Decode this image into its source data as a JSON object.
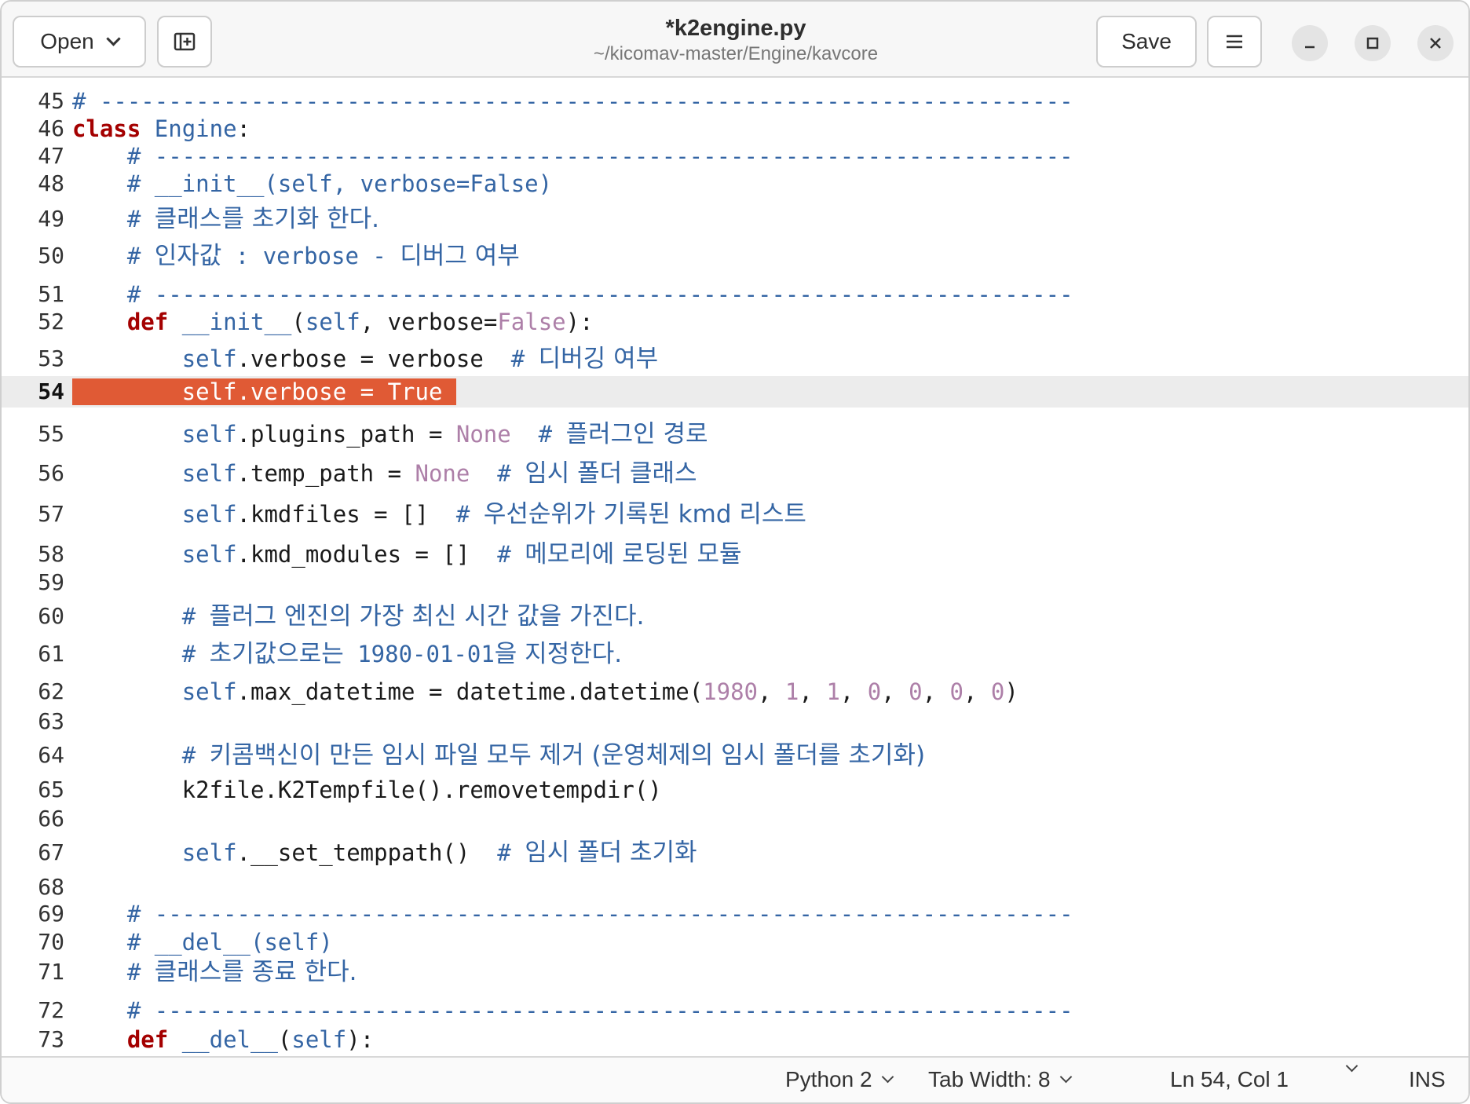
{
  "header": {
    "open_label": "Open",
    "title": "*k2engine.py",
    "path": "~/kicomav-master/Engine/kavcore",
    "save_label": "Save"
  },
  "icons": {
    "open_dropdown": "chevron-down-icon",
    "new_tab": "new-tab-icon",
    "menu": "hamburger-menu-icon",
    "minimize": "minimize-icon",
    "maximize": "maximize-icon",
    "close": "close-icon"
  },
  "colors": {
    "comment": "#3465a4",
    "keyword": "#a40000",
    "constant": "#ad7fa8",
    "current_line": "#ececec",
    "search_highlight": "#e05a35"
  },
  "editor": {
    "current_line": 54,
    "lines": [
      {
        "n": "45",
        "tokens": [
          {
            "t": "# -----------------------------------------------------------------------",
            "c": "cmt"
          }
        ]
      },
      {
        "n": "46",
        "tokens": [
          {
            "t": "class",
            "c": "kw"
          },
          {
            "t": " "
          },
          {
            "t": "Engine",
            "c": "cls"
          },
          {
            "t": ":"
          }
        ]
      },
      {
        "n": "47",
        "tokens": [
          {
            "t": "    "
          },
          {
            "t": "# -------------------------------------------------------------------",
            "c": "cmt"
          }
        ]
      },
      {
        "n": "48",
        "tokens": [
          {
            "t": "    "
          },
          {
            "t": "# __init__(self, verbose=False)",
            "c": "cmt"
          }
        ]
      },
      {
        "n": "49",
        "tokens": [
          {
            "t": "    "
          },
          {
            "t": "# ",
            "c": "cmt"
          },
          {
            "t": "클래스를 초기화 한다.",
            "c": "cmt ko"
          }
        ]
      },
      {
        "n": "50",
        "tokens": [
          {
            "t": "    "
          },
          {
            "t": "# ",
            "c": "cmt"
          },
          {
            "t": "인자값",
            "c": "cmt ko"
          },
          {
            "t": " : verbose - ",
            "c": "cmt"
          },
          {
            "t": "디버그 여부",
            "c": "cmt ko"
          }
        ]
      },
      {
        "n": "51",
        "tokens": [
          {
            "t": "    "
          },
          {
            "t": "# -------------------------------------------------------------------",
            "c": "cmt"
          }
        ]
      },
      {
        "n": "52",
        "tokens": [
          {
            "t": "    "
          },
          {
            "t": "def",
            "c": "kw"
          },
          {
            "t": " "
          },
          {
            "t": "__init__",
            "c": "cmt"
          },
          {
            "t": "("
          },
          {
            "t": "self",
            "c": "slf"
          },
          {
            "t": ", verbose="
          },
          {
            "t": "False",
            "c": "con"
          },
          {
            "t": "):"
          }
        ]
      },
      {
        "n": "53",
        "tokens": [
          {
            "t": "        "
          },
          {
            "t": "self",
            "c": "slf"
          },
          {
            "t": ".verbose = verbose  "
          },
          {
            "t": "# ",
            "c": "cmt"
          },
          {
            "t": "디버깅 여부",
            "c": "cmt ko"
          }
        ]
      },
      {
        "n": "54",
        "tokens": [
          {
            "t": "        self.verbose = True ",
            "c": "cur-hl"
          }
        ]
      },
      {
        "n": "55",
        "tokens": [
          {
            "t": "        "
          },
          {
            "t": "self",
            "c": "slf"
          },
          {
            "t": ".plugins_path = "
          },
          {
            "t": "None",
            "c": "con"
          },
          {
            "t": "  "
          },
          {
            "t": "# ",
            "c": "cmt"
          },
          {
            "t": "플러그인 경로",
            "c": "cmt ko"
          }
        ]
      },
      {
        "n": "56",
        "tokens": [
          {
            "t": "        "
          },
          {
            "t": "self",
            "c": "slf"
          },
          {
            "t": ".temp_path = "
          },
          {
            "t": "None",
            "c": "con"
          },
          {
            "t": "  "
          },
          {
            "t": "# ",
            "c": "cmt"
          },
          {
            "t": "임시 폴더 클래스",
            "c": "cmt ko"
          }
        ]
      },
      {
        "n": "57",
        "tokens": [
          {
            "t": "        "
          },
          {
            "t": "self",
            "c": "slf"
          },
          {
            "t": ".kmdfiles = []  "
          },
          {
            "t": "# ",
            "c": "cmt"
          },
          {
            "t": "우선순위가 기록된 kmd 리스트",
            "c": "cmt ko"
          }
        ]
      },
      {
        "n": "58",
        "tokens": [
          {
            "t": "        "
          },
          {
            "t": "self",
            "c": "slf"
          },
          {
            "t": ".kmd_modules = []  "
          },
          {
            "t": "# ",
            "c": "cmt"
          },
          {
            "t": "메모리에 로딩된 모듈",
            "c": "cmt ko"
          }
        ]
      },
      {
        "n": "59",
        "tokens": []
      },
      {
        "n": "60",
        "tokens": [
          {
            "t": "        "
          },
          {
            "t": "# ",
            "c": "cmt"
          },
          {
            "t": "플러그 엔진의 가장 최신 시간 값을 가진다.",
            "c": "cmt ko"
          }
        ]
      },
      {
        "n": "61",
        "tokens": [
          {
            "t": "        "
          },
          {
            "t": "# ",
            "c": "cmt"
          },
          {
            "t": "초기값으로는",
            "c": "cmt ko"
          },
          {
            "t": " 1980-01-01",
            "c": "cmt"
          },
          {
            "t": "을 지정한다.",
            "c": "cmt ko"
          }
        ]
      },
      {
        "n": "62",
        "tokens": [
          {
            "t": "        "
          },
          {
            "t": "self",
            "c": "slf"
          },
          {
            "t": ".max_datetime = datetime.datetime("
          },
          {
            "t": "1980",
            "c": "num"
          },
          {
            "t": ", "
          },
          {
            "t": "1",
            "c": "num"
          },
          {
            "t": ", "
          },
          {
            "t": "1",
            "c": "num"
          },
          {
            "t": ", "
          },
          {
            "t": "0",
            "c": "num"
          },
          {
            "t": ", "
          },
          {
            "t": "0",
            "c": "num"
          },
          {
            "t": ", "
          },
          {
            "t": "0",
            "c": "num"
          },
          {
            "t": ", "
          },
          {
            "t": "0",
            "c": "num"
          },
          {
            "t": ")"
          }
        ]
      },
      {
        "n": "63",
        "tokens": []
      },
      {
        "n": "64",
        "tokens": [
          {
            "t": "        "
          },
          {
            "t": "# ",
            "c": "cmt"
          },
          {
            "t": "키콤백신이 만든 임시 파일 모두 제거 (운영체제의 임시 폴더를 초기화)",
            "c": "cmt ko"
          }
        ]
      },
      {
        "n": "65",
        "tokens": [
          {
            "t": "        k2file.K2Tempfile().removetempdir()"
          }
        ]
      },
      {
        "n": "66",
        "tokens": []
      },
      {
        "n": "67",
        "tokens": [
          {
            "t": "        "
          },
          {
            "t": "self",
            "c": "slf"
          },
          {
            "t": ".__set_temppath()  "
          },
          {
            "t": "# ",
            "c": "cmt"
          },
          {
            "t": "임시 폴더 초기화",
            "c": "cmt ko"
          }
        ]
      },
      {
        "n": "68",
        "tokens": []
      },
      {
        "n": "69",
        "tokens": [
          {
            "t": "    "
          },
          {
            "t": "# -------------------------------------------------------------------",
            "c": "cmt"
          }
        ]
      },
      {
        "n": "70",
        "tokens": [
          {
            "t": "    "
          },
          {
            "t": "# __del__(self)",
            "c": "cmt"
          }
        ]
      },
      {
        "n": "71",
        "tokens": [
          {
            "t": "    "
          },
          {
            "t": "# ",
            "c": "cmt"
          },
          {
            "t": "클래스를 종료 한다.",
            "c": "cmt ko"
          }
        ]
      },
      {
        "n": "72",
        "tokens": [
          {
            "t": "    "
          },
          {
            "t": "# -------------------------------------------------------------------",
            "c": "cmt"
          }
        ]
      },
      {
        "n": "73",
        "tokens": [
          {
            "t": "    "
          },
          {
            "t": "def",
            "c": "kw"
          },
          {
            "t": " "
          },
          {
            "t": "__del__",
            "c": "cmt"
          },
          {
            "t": "("
          },
          {
            "t": "self",
            "c": "slf"
          },
          {
            "t": "):"
          }
        ]
      }
    ]
  },
  "status": {
    "language": "Python 2",
    "tab_width": "Tab Width: 8",
    "position": "Ln 54, Col 1",
    "mode": "INS"
  }
}
